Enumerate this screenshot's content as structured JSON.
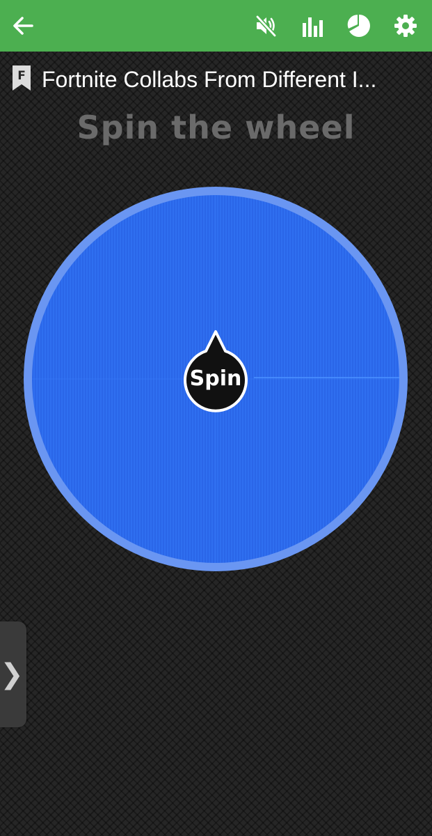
{
  "app": {
    "title": "Fortnite Collabs From Different I...",
    "heading": "Spin the wheel",
    "accent_color": "#4caf50",
    "wheel_color": "#2f6ff0",
    "wheel_rim_color": "#6a96f2"
  },
  "toolbar": {
    "icons": [
      "back-arrow-icon",
      "sound-muted-icon",
      "bar-chart-icon",
      "pie-chart-icon",
      "gear-icon"
    ]
  },
  "title_badge": {
    "letter": "F"
  },
  "spin_button": {
    "label": "Spin"
  },
  "side_tab": {
    "glyph": "❯"
  }
}
